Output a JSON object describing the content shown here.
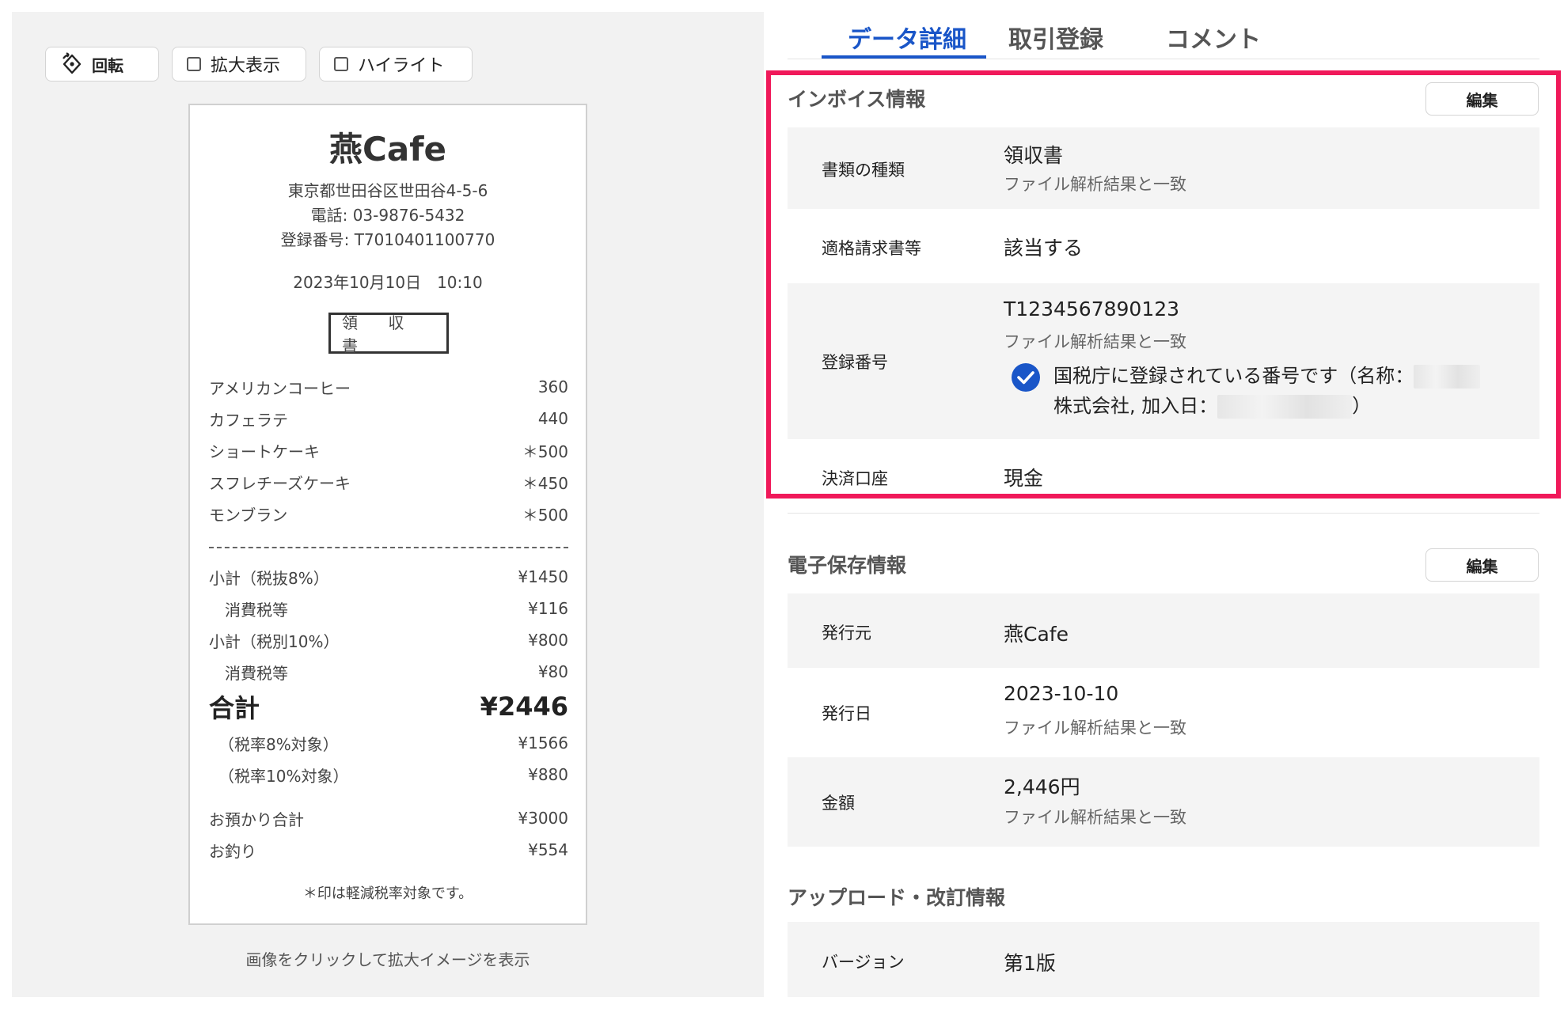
{
  "left_toolbar": {
    "rotate_label": "回転",
    "zoom_label": "拡大表示",
    "highlight_label": "ハイライト"
  },
  "receipt": {
    "shop": "燕Cafe",
    "address": "東京都世田谷区世田谷4-5-6",
    "phone": "電話: 03-9876-5432",
    "registration": "登録番号: T7010401100770",
    "datetime": "2023年10月10日　10:10",
    "title": "領 収 書",
    "items": [
      {
        "name": "アメリカンコーヒー",
        "price": "360"
      },
      {
        "name": "カフェラテ",
        "price": "440"
      },
      {
        "name": "ショートケーキ",
        "price": "＊500"
      },
      {
        "name": "スフレチーズケーキ",
        "price": "＊450"
      },
      {
        "name": "モンブラン",
        "price": "＊500"
      }
    ],
    "subtotals": [
      {
        "name": "小計（税抜8%）",
        "price": "¥1450"
      },
      {
        "name": "消費税等",
        "price": "¥116"
      },
      {
        "name": "小計（税別10%）",
        "price": "¥800"
      },
      {
        "name": "消費税等",
        "price": "¥80"
      }
    ],
    "total_label": "合計",
    "total_value": "¥2446",
    "tax_breakdown": [
      {
        "name": "（税率8%対象）",
        "price": "¥1566"
      },
      {
        "name": "（税率10%対象）",
        "price": "¥880"
      }
    ],
    "payment": [
      {
        "name": "お預かり合計",
        "price": "¥3000"
      },
      {
        "name": "お釣り",
        "price": "¥554"
      }
    ],
    "note": "＊印は軽減税率対象です。"
  },
  "image_hint": "画像をクリックして拡大イメージを表示",
  "tabs": [
    "データ詳細",
    "取引登録",
    "コメント"
  ],
  "active_tab": "データ詳細",
  "invoice": {
    "title": "インボイス情報",
    "edit_label": "編集",
    "doc_type_label": "書類の種類",
    "doc_type_value": "領収書",
    "doc_type_sub": "ファイル解析結果と一致",
    "qualified_label": "適格請求書等",
    "qualified_value": "該当する",
    "reg_label": "登録番号",
    "reg_value": "T1234567890123",
    "reg_sub": "ファイル解析結果と一致",
    "verify_line1": "国税庁に登録されている番号です（名称：",
    "verify_line2_a": "株式会社, 加入日：",
    "verify_line2_b": "）",
    "account_label": "決済口座",
    "account_value": "現金"
  },
  "estorage": {
    "title": "電子保存情報",
    "edit_label": "編集",
    "issuer_label": "発行元",
    "issuer_value": "燕Cafe",
    "date_label": "発行日",
    "date_value": "2023-10-10",
    "date_sub": "ファイル解析結果と一致",
    "amount_label": "金額",
    "amount_value": "2,446円",
    "amount_sub": "ファイル解析結果と一致"
  },
  "upload": {
    "title": "アップロード・改訂情報",
    "version_label": "バージョン",
    "version_value": "第1版"
  },
  "colors": {
    "accent_blue": "#1a56c8",
    "highlight_pink": "#f0195a",
    "row_gray": "#f4f4f4"
  }
}
